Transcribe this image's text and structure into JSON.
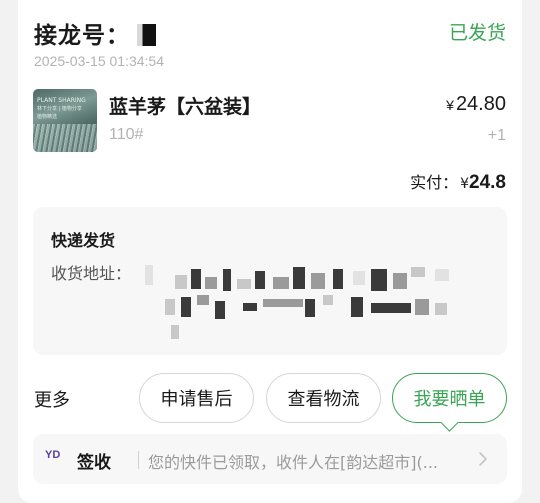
{
  "order": {
    "jielong_label": "接龙号：",
    "status": "已发货",
    "timestamp": "2025-03-15 01:34:54"
  },
  "product": {
    "thumb_line1": "PLANT SHARING",
    "thumb_line2": "林下分享 | 植物分享",
    "thumb_line3": "植物精选",
    "name": "蓝羊茅【六盆装】",
    "currency": "¥",
    "price": "24.80",
    "sku": "110#",
    "quantity": "+1"
  },
  "payment": {
    "label": "实付：",
    "currency": "¥",
    "amount": "24.8"
  },
  "shipping": {
    "title": "快递发货",
    "address_label": "收货地址："
  },
  "actions": {
    "more_label": "更多",
    "after_sale": "申请售后",
    "view_logistics": "查看物流",
    "share_review": "我要晒单"
  },
  "tracking": {
    "carrier_logo": "YD",
    "sign_label": "签收",
    "message": "您的快件已领取，收件人在[韵达超市](..."
  },
  "icons": {
    "chevron": "chevron-right-icon",
    "carrier": "yunda-logo-icon"
  },
  "colors": {
    "accent_green": "#3aa655",
    "muted_text": "#b3b3b3"
  }
}
